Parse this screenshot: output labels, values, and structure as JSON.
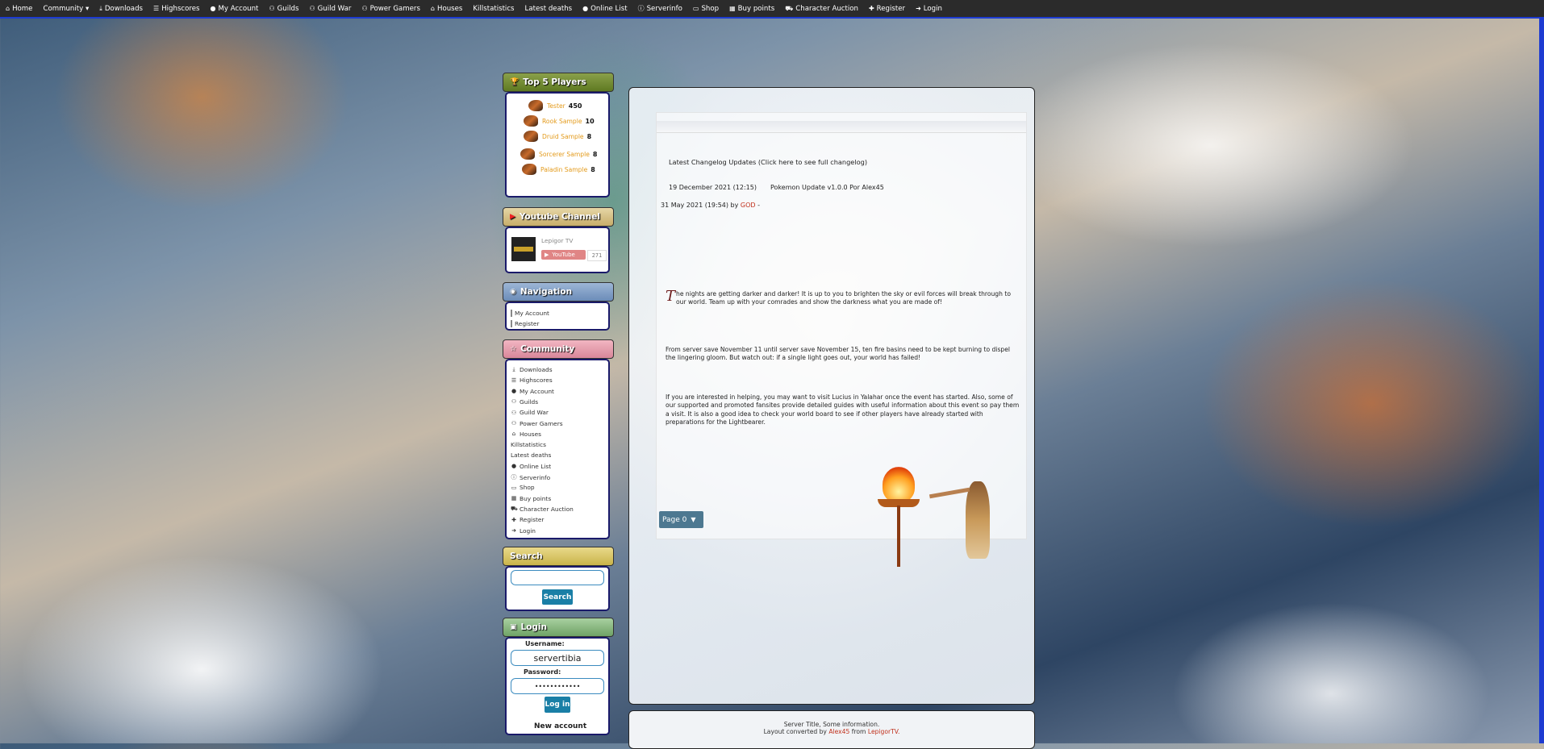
{
  "topnav": [
    {
      "icon": "home-icon",
      "glyph": "⌂",
      "label": "Home"
    },
    {
      "icon": "",
      "glyph": "",
      "label": "Community ▾"
    },
    {
      "icon": "download-icon",
      "glyph": "⤓",
      "label": "Downloads"
    },
    {
      "icon": "list-icon",
      "glyph": "☰",
      "label": "Highscores"
    },
    {
      "icon": "user-icon",
      "glyph": "●",
      "label": "My Account"
    },
    {
      "icon": "users-icon",
      "glyph": "⚇",
      "label": "Guilds"
    },
    {
      "icon": "users-icon",
      "glyph": "⚇",
      "label": "Guild War"
    },
    {
      "icon": "users-icon",
      "glyph": "⚇",
      "label": "Power Gamers"
    },
    {
      "icon": "home-icon",
      "glyph": "⌂",
      "label": "Houses"
    },
    {
      "icon": "",
      "glyph": "",
      "label": "Killstatistics"
    },
    {
      "icon": "",
      "glyph": "",
      "label": "Latest deaths"
    },
    {
      "icon": "circle-icon",
      "glyph": "●",
      "label": "Online List"
    },
    {
      "icon": "info-icon",
      "glyph": "ⓘ",
      "label": "Serverinfo"
    },
    {
      "icon": "card-icon",
      "glyph": "▭",
      "label": "Shop"
    },
    {
      "icon": "store-icon",
      "glyph": "▦",
      "label": "Buy points"
    },
    {
      "icon": "cart-icon",
      "glyph": "⛟",
      "label": "Character Auction"
    },
    {
      "icon": "user-plus-icon",
      "glyph": "✚",
      "label": "Register"
    },
    {
      "icon": "login-icon",
      "glyph": "➜",
      "label": "Login"
    }
  ],
  "top_players": {
    "title": "Top 5 Players",
    "players": [
      {
        "name": "Tester",
        "score": "450"
      },
      {
        "name": "Rook Sample",
        "score": "10"
      },
      {
        "name": "Druid Sample",
        "score": "8"
      },
      {
        "name": "Sorcerer Sample",
        "score": "8"
      },
      {
        "name": "Paladin Sample",
        "score": "8"
      }
    ]
  },
  "youtube": {
    "title": "Youtube Channel",
    "channel": "Lepigor TV",
    "button": "YouTube",
    "count": "271"
  },
  "navigation": {
    "title": "Navigation",
    "items": [
      "My Account",
      "Register"
    ]
  },
  "community": {
    "title": "Community",
    "items": [
      {
        "glyph": "⤓",
        "label": "Downloads"
      },
      {
        "glyph": "☰",
        "label": "Highscores"
      },
      {
        "glyph": "●",
        "label": "My Account"
      },
      {
        "glyph": "⚇",
        "label": "Guilds"
      },
      {
        "glyph": "⚇",
        "label": "Guild War"
      },
      {
        "glyph": "⚇",
        "label": "Power Gamers"
      },
      {
        "glyph": "⌂",
        "label": "Houses"
      },
      {
        "glyph": "",
        "label": "Killstatistics"
      },
      {
        "glyph": "",
        "label": "Latest deaths"
      },
      {
        "glyph": "●",
        "label": "Online List"
      },
      {
        "glyph": "ⓘ",
        "label": "Serverinfo"
      },
      {
        "glyph": "▭",
        "label": "Shop"
      },
      {
        "glyph": "▦",
        "label": "Buy points"
      },
      {
        "glyph": "⛟",
        "label": "Character Auction"
      },
      {
        "glyph": "✚",
        "label": "Register"
      },
      {
        "glyph": "➜",
        "label": "Login"
      }
    ]
  },
  "search": {
    "title": "Search",
    "button": "Search"
  },
  "login": {
    "title": "Login",
    "username_label": "Username:",
    "username_value": "servertibia",
    "password_label": "Password:",
    "password_value": "••••••••••••",
    "button": "Log in",
    "new_account": "New account"
  },
  "main": {
    "changelog_label": "Latest Changelog Updates (Click here to see full changelog)",
    "changelog_date": "19 December 2021 (12:15)",
    "changelog_text": "Pokemon Update v1.0.0 Por Alex45",
    "news_date": "31 May 2021 (19:54) by",
    "news_author": "GOD",
    "news_dash": " -",
    "dropcap": "T",
    "para1": "he nights are getting darker and darker! It is up to you to brighten the sky or evil forces will break through to our world. Team up with your comrades and show the darkness what you are made of!",
    "para2": "From server save November 11 until server save November 15, ten fire basins need to be kept burning to dispel the lingering gloom. But watch out: if a single light goes out, your world has failed!",
    "para3": "If you are interested in helping, you may want to visit Lucius in Yalahar once the event has started. Also, some of our supported and promoted fansites provide detailed guides with useful information about this event so pay them a visit. It is also a good idea to check your world board to see if other players have already started with preparations for the Lightbearer.",
    "page_select": "Page 0"
  },
  "footer": {
    "line1": "Server Title, Some information.",
    "line2_prefix": "Layout converted by",
    "author": "Alex45",
    "line2_mid": "from",
    "site": "LepigorTV."
  },
  "colors": {
    "accent": "#1d3bd1",
    "button": "#1a7fa6",
    "orange_link": "#e39a1a",
    "red_link": "#c0301c"
  }
}
